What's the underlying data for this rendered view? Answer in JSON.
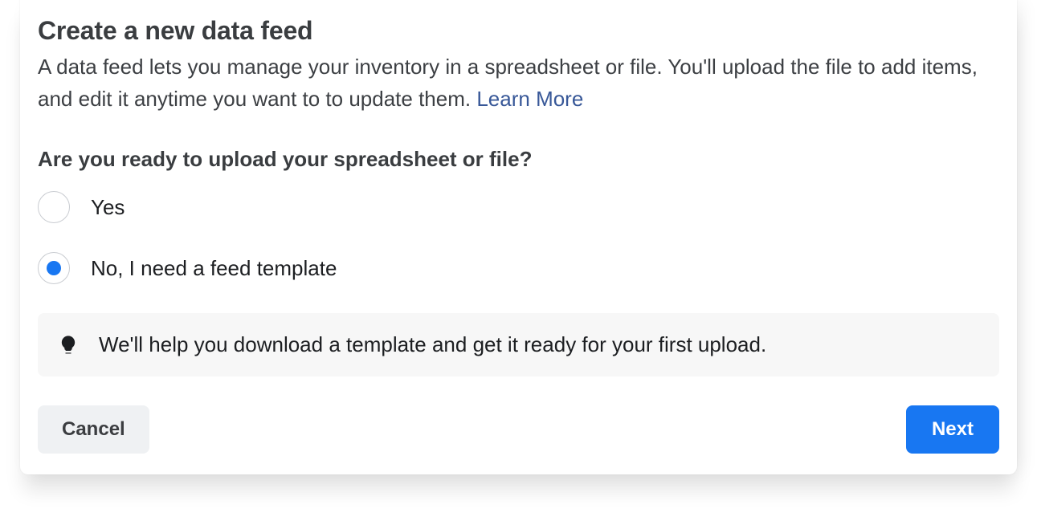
{
  "header": {
    "title": "Create a new data feed",
    "description": "A data feed lets you manage your inventory in a spreadsheet or file. You'll upload the file to add items, and edit it anytime you want to to update them. ",
    "learn_more": "Learn More"
  },
  "question": "Are you ready to upload your spreadsheet or file?",
  "options": {
    "yes": {
      "label": "Yes",
      "selected": false
    },
    "no": {
      "label": "No, I need a feed template",
      "selected": true
    }
  },
  "info": {
    "message": "We'll help you download a template and get it ready for your first upload."
  },
  "footer": {
    "cancel": "Cancel",
    "next": "Next"
  }
}
